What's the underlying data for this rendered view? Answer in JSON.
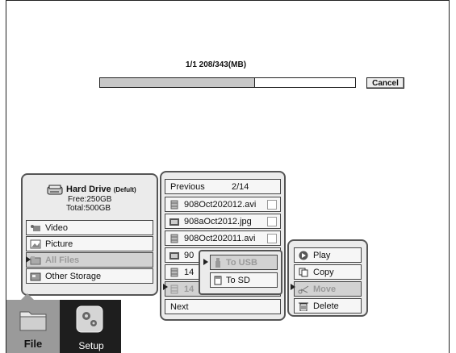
{
  "progress": {
    "text": "1/1 208/343(MB)",
    "fraction": 0.606,
    "cancel_label": "Cancel"
  },
  "drive": {
    "name": "Hard Drive",
    "tag": "(Defult)",
    "free": "Free:250GB",
    "total": "Total:500GB"
  },
  "categories": [
    {
      "label": "Video",
      "icon": "video-icon"
    },
    {
      "label": "Picture",
      "icon": "picture-icon"
    },
    {
      "label": "All Files",
      "icon": "folder-icon"
    },
    {
      "label": "Other Storage",
      "icon": "storage-icon"
    }
  ],
  "files": {
    "previous_label": "Previous",
    "page": "2/14",
    "items": [
      {
        "name": "908Oct202012.avi",
        "icon": "video-file-icon"
      },
      {
        "name": "908aOct2012.jpg",
        "icon": "image-file-icon"
      },
      {
        "name": "908Oct202011.avi",
        "icon": "video-file-icon"
      },
      {
        "name": "90",
        "icon": "image-file-icon"
      },
      {
        "name": "14",
        "icon": "video-file-icon"
      },
      {
        "name": "14",
        "icon": "video-file-icon"
      }
    ],
    "next_label": "Next"
  },
  "move_menu": {
    "to_usb": "To USB",
    "to_sd": "To SD"
  },
  "actions": [
    {
      "label": "Play",
      "icon": "play-icon"
    },
    {
      "label": "Copy",
      "icon": "copy-icon"
    },
    {
      "label": "Move",
      "icon": "scissors-icon"
    },
    {
      "label": "Delete",
      "icon": "trash-icon"
    }
  ],
  "bottom_tabs": {
    "file": "File",
    "setup": "Setup"
  },
  "colors": {
    "panel_bg": "#ebebeb",
    "progress_fill": "#c8c8c8",
    "tab_bar": "#1e1e1e"
  }
}
